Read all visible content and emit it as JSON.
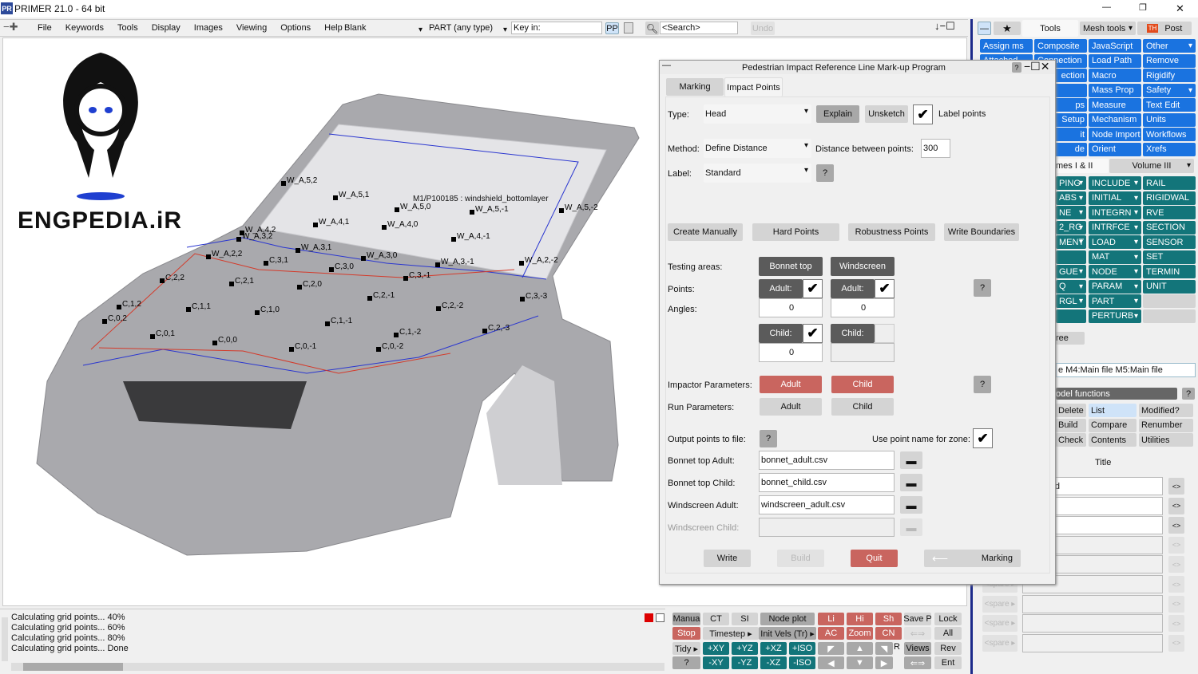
{
  "window": {
    "app_icon": "PR",
    "title": "PRIMER 21.0 - 64 bit",
    "controls": [
      "—",
      "❐",
      "✕"
    ]
  },
  "menubar": {
    "items": [
      "File",
      "Keywords",
      "Tools",
      "Display",
      "Images",
      "Viewing",
      "Options",
      "Help"
    ],
    "view_select": "Blank",
    "entity_select": "PART  (any type)",
    "keyin_placeholder": "Key in:",
    "pp": "PP",
    "search_placeholder": "<Search>",
    "undo": "Undo"
  },
  "logo": {
    "text": "ENGPEDIA.iR"
  },
  "viewport": {
    "annotation": "M1/P100185 : windshield_bottomlayer",
    "points": [
      "W_A,5,2",
      "W_A,5,1",
      "W_A,5,0",
      "W_A,5,-1",
      "W_A,5,-2",
      "W_A,4,2",
      "W_A,3,2",
      "W_A,4,1",
      "W_A,4,0",
      "W_A,4,-1",
      "W_A,3,1",
      "W_A,3,0",
      "W_A,3,-1",
      "W_A,2,2",
      "C,3,1",
      "C,3,0",
      "C,3,-1",
      "W_A,2,-2",
      "C,2,2",
      "C,2,1",
      "C,2,0",
      "C,2,-1",
      "C,3,-3",
      "C,1,2",
      "C,1,1",
      "C,1,0",
      "C,2,-2",
      "C,0,2",
      "C,0,1",
      "C,0,0",
      "C,1,-1",
      "C,1,-2",
      "C,2,-3",
      "C,0,-1",
      "C,0,-2"
    ]
  },
  "dialog": {
    "title": "Pedestrian Impact Reference Line Mark-up Program",
    "help": "?",
    "tabs": [
      "Marking",
      "Impact Points"
    ],
    "active_tab": "Impact Points",
    "type_label": "Type:",
    "type_value": "Head",
    "explain": "Explain",
    "unsketch": "Unsketch",
    "label_points": "Label points",
    "label_points_checked": true,
    "method_label": "Method:",
    "method_value": "Define Distance",
    "distance_label": "Distance between points:",
    "distance_value": "300",
    "label_label": "Label:",
    "label_value": "Standard",
    "q": "?",
    "actions": [
      "Create Manually",
      "Hard Points",
      "Robustness Points",
      "Write Boundaries"
    ],
    "testing_areas_label": "Testing areas:",
    "areas": [
      "Bonnet top",
      "Windscreen"
    ],
    "points_label": "Points:",
    "angles_label": "Angles:",
    "adult": "Adult:",
    "child": "Child:",
    "bonnet_adult_checked": true,
    "windscreen_adult_checked": true,
    "bonnet_child_checked": true,
    "windscreen_child_checked": false,
    "bonnet_adult_angle": "0",
    "windscreen_adult_angle": "0",
    "bonnet_child_angle": "0",
    "impactor_label": "Impactor Parameters:",
    "run_label": "Run Parameters:",
    "adult_btn": "Adult",
    "child_btn": "Child",
    "output_label": "Output points to file:",
    "use_point_name": "Use point name for zone:",
    "use_point_name_checked": true,
    "files": [
      {
        "label": "Bonnet top Adult:",
        "value": "bonnet_adult.csv"
      },
      {
        "label": "Bonnet top Child:",
        "value": "bonnet_child.csv"
      },
      {
        "label": "Windscreen Adult:",
        "value": "windscreen_adult.csv"
      },
      {
        "label": "Windscreen Child:",
        "value": ""
      }
    ],
    "write": "Write",
    "build": "Build",
    "quit": "Quit",
    "marking": "Marking"
  },
  "right_panel": {
    "top_tabs": [
      "Tools",
      "Mesh tools",
      "Post"
    ],
    "active_tab": "Tools",
    "star": "★",
    "minus": "—",
    "tools": [
      [
        "Assign ms",
        "Composite",
        "JavaScript",
        "Other"
      ],
      [
        "Attached",
        "Connection",
        "Load Path",
        "Remove"
      ],
      [
        "",
        "ection",
        "Macro",
        "Rigidify"
      ],
      [
        "",
        "",
        "Mass Prop",
        "Safety"
      ],
      [
        "",
        "ps",
        "Measure",
        "Text Edit"
      ],
      [
        "",
        "Setup",
        "Mechanism",
        "Units"
      ],
      [
        "",
        "it",
        "Node Import",
        "Workflows"
      ],
      [
        "",
        "de",
        "Orient",
        "Xrefs"
      ]
    ],
    "volume_tabs": [
      "mes I & II",
      "Volume III"
    ],
    "keywords": [
      [
        "PING",
        "INCLUDE",
        "RAIL"
      ],
      [
        "ABS",
        "INITIAL",
        "RIGIDWAL"
      ],
      [
        "NE",
        "INTEGRN",
        "RVE"
      ],
      [
        "2_RG",
        "INTRFCE",
        "SECTION"
      ],
      [
        "MENT",
        "LOAD",
        "SENSOR"
      ],
      [
        "",
        "MAT",
        "SET"
      ],
      [
        "GUE",
        "NODE",
        "TERMIN"
      ],
      [
        "Q",
        "PARAM",
        "UNIT"
      ],
      [
        "RGL",
        "PART",
        ""
      ],
      [
        "",
        "PERTURB",
        ""
      ]
    ],
    "tree_btn": "ree",
    "model_field": "e M4:Main file M5:Main file",
    "model_functions": "odel functions",
    "functions": [
      [
        "Delete",
        "List",
        "Modified?"
      ],
      [
        "Build",
        "Compare",
        "Renumber"
      ],
      [
        "Check",
        "Contents",
        "Utilities"
      ]
    ],
    "title_header": "Title",
    "rows": [
      "Pedhead",
      "",
      "",
      "",
      "",
      "",
      "",
      "",
      ""
    ],
    "spare": "<spare ▸",
    "swap": "<>"
  },
  "status": {
    "lines": [
      "Calculating grid points... 40%",
      "Calculating grid points... 60%",
      "Calculating grid points... 80%",
      "Calculating grid points... Done"
    ]
  },
  "bottom_toolbar": {
    "r1": [
      "Manua",
      "CT",
      "SI",
      "Node plot",
      "Li",
      "Hi",
      "Sh",
      "Save P",
      "Lock"
    ],
    "r2": [
      "Stop",
      "Timestep ▸",
      "Init Vels (Tr) ▸",
      "AC",
      "Zoom",
      "CN",
      "All"
    ],
    "r3": [
      "Tidy ▸",
      "+XY",
      "+YZ",
      "+XZ",
      "+ISO",
      "R",
      "Views",
      "Rev"
    ],
    "r4": [
      "?",
      "-XY",
      "-YZ",
      "-XZ",
      "-ISO",
      "Ent"
    ]
  },
  "colors": {
    "accent_blue": "#1a73e0",
    "teal": "#13757a",
    "red": "#c9655f",
    "dark_gray": "#5b5b5b"
  }
}
